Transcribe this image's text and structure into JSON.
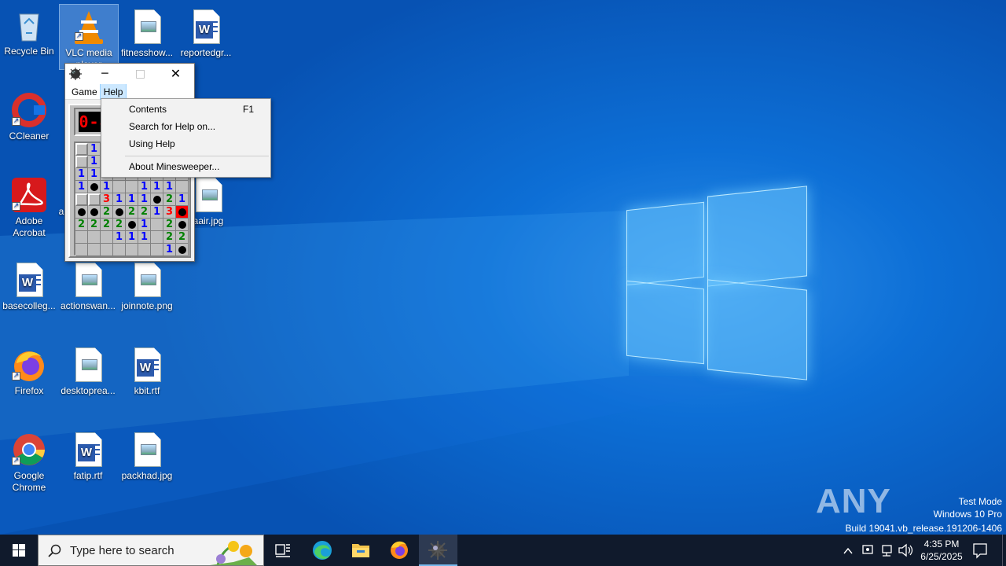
{
  "desktop_icons": [
    {
      "label": "Recycle Bin",
      "icon": "recycle-bin-icon"
    },
    {
      "label": "VLC media player",
      "icon": "vlc-icon"
    },
    {
      "label": "fitnesshow...",
      "icon": "image-file-icon"
    },
    {
      "label": "reportedgr...",
      "icon": "word-file-icon"
    },
    {
      "label": "CCleaner",
      "icon": "ccleaner-icon"
    },
    {
      "label": "Adobe Acrobat",
      "icon": "acrobat-icon"
    },
    {
      "label": "a",
      "icon": "file-icon"
    },
    {
      "label": "aair.jpg",
      "icon": "image-file-icon"
    },
    {
      "label": "basecolleg...",
      "icon": "word-file-icon"
    },
    {
      "label": "actionswan...",
      "icon": "image-file-icon"
    },
    {
      "label": "joinnote.png",
      "icon": "image-file-icon"
    },
    {
      "label": "Firefox",
      "icon": "firefox-icon"
    },
    {
      "label": "desktoprea...",
      "icon": "image-file-icon"
    },
    {
      "label": "kbit.rtf",
      "icon": "word-file-icon"
    },
    {
      "label": "Google Chrome",
      "icon": "chrome-icon"
    },
    {
      "label": "fatip.rtf",
      "icon": "word-file-icon"
    },
    {
      "label": "packhad.jpg",
      "icon": "image-file-icon"
    }
  ],
  "minesweeper": {
    "title_controls": {
      "minimize": "─",
      "maximize": "□",
      "close": "✕"
    },
    "menu": {
      "game": "Game",
      "help": "Help"
    },
    "mine_counter": "0-8",
    "grid": [
      [
        "u",
        "1",
        "",
        "",
        "",
        "",
        "",
        "",
        ""
      ],
      [
        "u",
        "1",
        "",
        "",
        "",
        "",
        "",
        "",
        ""
      ],
      [
        "1",
        "1",
        "",
        "",
        "",
        "",
        "",
        "",
        ""
      ],
      [
        "1",
        "m",
        "1",
        "",
        "",
        "1",
        "1",
        "1",
        ""
      ],
      [
        "u",
        "u",
        "3",
        "1",
        "1",
        "1",
        "m",
        "2",
        "1"
      ],
      [
        "m",
        "m",
        "2",
        "m",
        "2",
        "2",
        "1",
        "3",
        "x"
      ],
      [
        "2",
        "2",
        "2",
        "2",
        "m",
        "1",
        "",
        "2",
        "m"
      ],
      [
        "",
        "",
        "",
        "1",
        "1",
        "1",
        "",
        "2",
        "2"
      ],
      [
        "",
        "",
        "",
        "",
        "",
        "",
        "",
        "1",
        "m"
      ]
    ]
  },
  "help_menu": {
    "items": [
      {
        "label": "Contents",
        "accel": "F1"
      },
      {
        "label": "Search for Help on...",
        "accel": ""
      },
      {
        "label": "Using Help",
        "accel": ""
      },
      {
        "label": "About Minesweeper...",
        "accel": ""
      }
    ]
  },
  "taskbar": {
    "search_placeholder": "Type here to search",
    "time": "4:35 PM",
    "date": "6/25/2025"
  },
  "watermark": {
    "brand": "ANY RUN",
    "mode": "Test Mode",
    "os": "Windows 10 Pro",
    "build": "Build 19041.vb_release.191206-1406"
  }
}
